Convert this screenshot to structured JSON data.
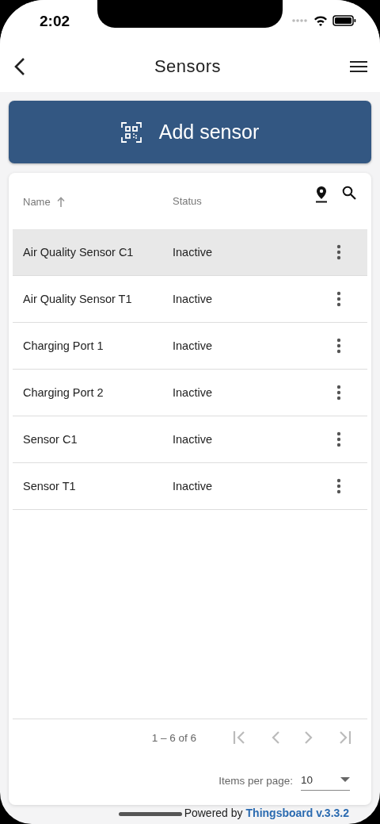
{
  "status_bar": {
    "time": "2:02"
  },
  "header": {
    "title": "Sensors"
  },
  "add_button": {
    "label": "Add sensor"
  },
  "table": {
    "columns": [
      {
        "label": "Name",
        "sorted": true
      },
      {
        "label": "Status",
        "sorted": false
      }
    ],
    "rows": [
      {
        "name": "Air Quality Sensor C1",
        "status": "Inactive",
        "selected": true
      },
      {
        "name": "Air Quality Sensor T1",
        "status": "Inactive",
        "selected": false
      },
      {
        "name": "Charging Port 1",
        "status": "Inactive",
        "selected": false
      },
      {
        "name": "Charging Port 2",
        "status": "Inactive",
        "selected": false
      },
      {
        "name": "Sensor C1",
        "status": "Inactive",
        "selected": false
      },
      {
        "name": "Sensor T1",
        "status": "Inactive",
        "selected": false
      }
    ]
  },
  "paginator": {
    "range": "1 – 6 of 6",
    "first_disabled": true,
    "prev_disabled": true,
    "next_disabled": true,
    "last_disabled": true,
    "items_per_page_label": "Items per page:",
    "items_per_page": "10"
  },
  "footer": {
    "prefix": "Powered by",
    "link": "Thingsboard v.3.3.2"
  }
}
